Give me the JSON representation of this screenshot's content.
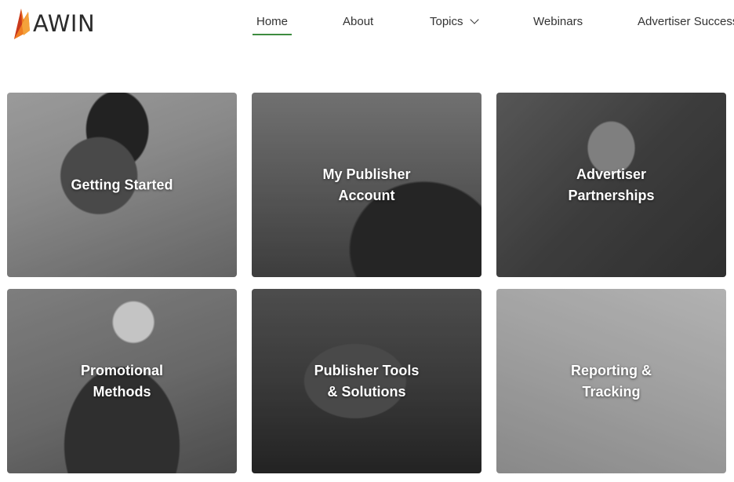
{
  "brand": {
    "name": "AWIN",
    "logo_icon": "awin-flame-logo",
    "accent": "#f07d22",
    "nav_underline": "#3d8c40"
  },
  "nav": {
    "items": [
      {
        "label": "Home",
        "active": true
      },
      {
        "label": "About"
      },
      {
        "label": "Topics",
        "icon": "chevron-down-icon"
      },
      {
        "label": "Webinars"
      },
      {
        "label": "Advertiser Success"
      }
    ]
  },
  "tiles": [
    {
      "lines": [
        "Getting Started"
      ]
    },
    {
      "lines": [
        "My Publisher",
        "Account"
      ]
    },
    {
      "lines": [
        "Advertiser",
        "Partnerships"
      ]
    },
    {
      "lines": [
        "Promotional",
        "Methods"
      ]
    },
    {
      "lines": [
        "Publisher Tools",
        "& Solutions"
      ]
    },
    {
      "lines": [
        "Reporting &",
        "Tracking"
      ]
    }
  ]
}
